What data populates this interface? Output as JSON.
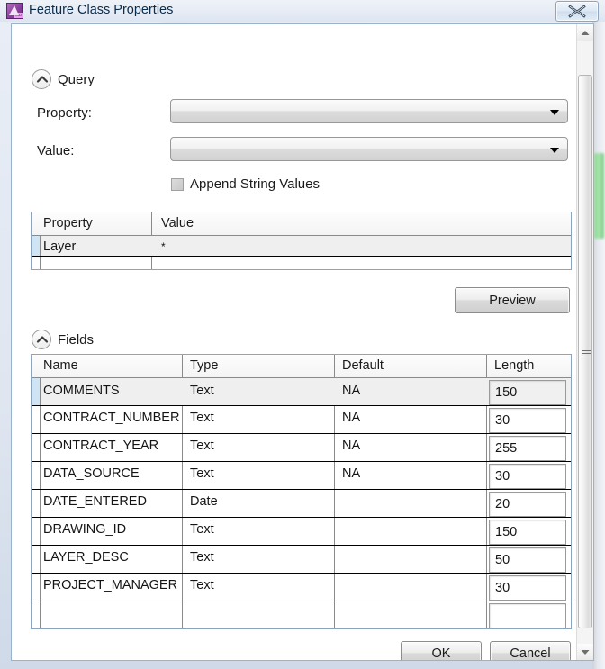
{
  "window": {
    "title": "Feature Class Properties",
    "icon": "feature-class-icon",
    "close_label": "✕"
  },
  "query_section": {
    "title": "Query",
    "toggle_icon": "chevron-up-icon",
    "property_label": "Property:",
    "property_value": "",
    "value_label": "Value:",
    "value_value": "",
    "append_checkbox_label": "Append String Values",
    "append_checkbox_checked": false,
    "grid": {
      "columns": [
        "Property",
        "Value"
      ],
      "rows": [
        {
          "property": "Layer",
          "value": "*",
          "selected": true
        },
        {
          "property": "",
          "value": "",
          "selected": false
        }
      ]
    },
    "preview_button": "Preview"
  },
  "fields_section": {
    "title": "Fields",
    "toggle_icon": "chevron-up-icon",
    "grid": {
      "columns": [
        "Name",
        "Type",
        "Default",
        "Length"
      ],
      "rows": [
        {
          "name": "COMMENTS",
          "type": "Text",
          "default": "NA",
          "length": "150",
          "selected": true
        },
        {
          "name": "CONTRACT_NUMBER",
          "type": "Text",
          "default": "NA",
          "length": "30",
          "selected": false
        },
        {
          "name": "CONTRACT_YEAR",
          "type": "Text",
          "default": "NA",
          "length": "255",
          "selected": false
        },
        {
          "name": "DATA_SOURCE",
          "type": "Text",
          "default": "NA",
          "length": "30",
          "selected": false
        },
        {
          "name": "DATE_ENTERED",
          "type": "Date",
          "default": "",
          "length": "20",
          "selected": false
        },
        {
          "name": "DRAWING_ID",
          "type": "Text",
          "default": "",
          "length": "150",
          "selected": false
        },
        {
          "name": "LAYER_DESC",
          "type": "Text",
          "default": "",
          "length": "50",
          "selected": false
        },
        {
          "name": "PROJECT_MANAGER",
          "type": "Text",
          "default": "",
          "length": "30",
          "selected": false
        },
        {
          "name": "",
          "type": "",
          "default": "",
          "length": "",
          "selected": false
        }
      ]
    }
  },
  "footer": {
    "ok_label": "OK",
    "cancel_label": "Cancel"
  },
  "scrollbar": {
    "up_icon": "triangle-up-icon",
    "down_icon": "triangle-down-icon",
    "grip_icon": "grip-lines-icon"
  },
  "colors": {
    "title_text": "#0b2b4a",
    "grid_border": "#8ba4c0",
    "selected_row": "#efefef",
    "selection_strip": "#cfe4f5",
    "bg_accent_green": "#86d68b"
  }
}
